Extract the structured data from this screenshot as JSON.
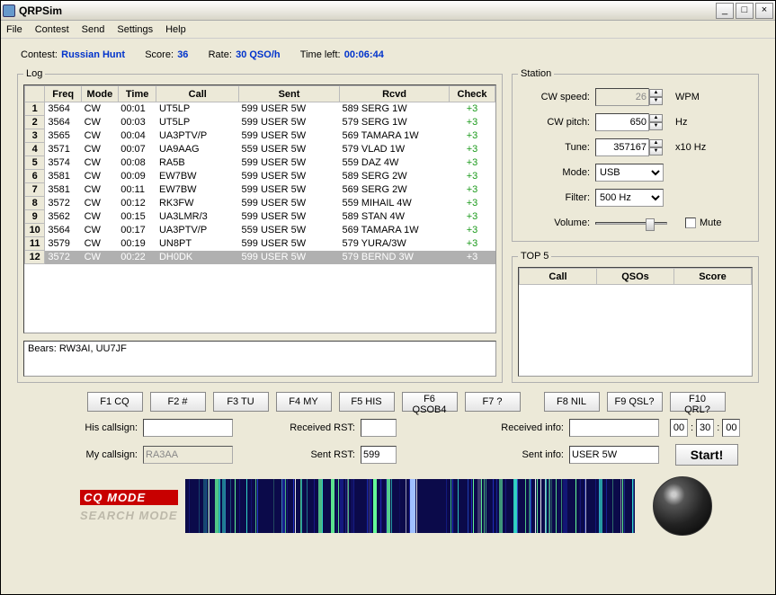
{
  "window": {
    "title": "QRPSim"
  },
  "menu": [
    "File",
    "Contest",
    "Send",
    "Settings",
    "Help"
  ],
  "summary": {
    "contest_lbl": "Contest:",
    "contest_val": "Russian Hunt",
    "score_lbl": "Score:",
    "score_val": "36",
    "rate_lbl": "Rate:",
    "rate_val": "30 QSO/h",
    "timeleft_lbl": "Time left:",
    "timeleft_val": "00:06:44"
  },
  "log": {
    "legend": "Log",
    "headers": [
      "#",
      "Freq",
      "Mode",
      "Time",
      "Call",
      "Sent",
      "Rcvd",
      "Check"
    ],
    "rows": [
      {
        "n": "1",
        "freq": "3564",
        "mode": "CW",
        "time": "00:01",
        "call": "UT5LP",
        "sent": "599 USER 5W",
        "rcvd": "589 SERG 1W",
        "check": "+3"
      },
      {
        "n": "2",
        "freq": "3564",
        "mode": "CW",
        "time": "00:03",
        "call": "UT5LP",
        "sent": "599 USER 5W",
        "rcvd": "579 SERG 1W",
        "check": "+3"
      },
      {
        "n": "3",
        "freq": "3565",
        "mode": "CW",
        "time": "00:04",
        "call": "UA3PTV/P",
        "sent": "599 USER 5W",
        "rcvd": "569 TAMARA 1W",
        "check": "+3"
      },
      {
        "n": "4",
        "freq": "3571",
        "mode": "CW",
        "time": "00:07",
        "call": "UA9AAG",
        "sent": "559 USER 5W",
        "rcvd": "579 VLAD 1W",
        "check": "+3"
      },
      {
        "n": "5",
        "freq": "3574",
        "mode": "CW",
        "time": "00:08",
        "call": "RA5B",
        "sent": "599 USER 5W",
        "rcvd": "559 DAZ 4W",
        "check": "+3"
      },
      {
        "n": "6",
        "freq": "3581",
        "mode": "CW",
        "time": "00:09",
        "call": "EW7BW",
        "sent": "599 USER 5W",
        "rcvd": "589 SERG 2W",
        "check": "+3"
      },
      {
        "n": "7",
        "freq": "3581",
        "mode": "CW",
        "time": "00:11",
        "call": "EW7BW",
        "sent": "599 USER 5W",
        "rcvd": "569 SERG 2W",
        "check": "+3"
      },
      {
        "n": "8",
        "freq": "3572",
        "mode": "CW",
        "time": "00:12",
        "call": "RK3FW",
        "sent": "599 USER 5W",
        "rcvd": "559 MIHAIL 4W",
        "check": "+3"
      },
      {
        "n": "9",
        "freq": "3562",
        "mode": "CW",
        "time": "00:15",
        "call": "UA3LMR/3",
        "sent": "599 USER 5W",
        "rcvd": "589 STAN 4W",
        "check": "+3"
      },
      {
        "n": "10",
        "freq": "3564",
        "mode": "CW",
        "time": "00:17",
        "call": "UA3PTV/P",
        "sent": "559 USER 5W",
        "rcvd": "569 TAMARA 1W",
        "check": "+3"
      },
      {
        "n": "11",
        "freq": "3579",
        "mode": "CW",
        "time": "00:19",
        "call": "UN8PT",
        "sent": "599 USER 5W",
        "rcvd": "579 YURA/3W",
        "check": "+3"
      },
      {
        "n": "12",
        "freq": "3572",
        "mode": "CW",
        "time": "00:22",
        "call": "DH0DK",
        "sent": "599 USER 5W",
        "rcvd": "579 BERND 3W",
        "check": "+3",
        "selected": true
      }
    ],
    "bears_label": "Bears: RW3AI, UU7JF"
  },
  "station": {
    "legend": "Station",
    "cw_speed_lbl": "CW speed:",
    "cw_speed": "26",
    "wpm": "WPM",
    "cw_pitch_lbl": "CW pitch:",
    "cw_pitch": "650",
    "hz": "Hz",
    "tune_lbl": "Tune:",
    "tune": "357167",
    "x10hz": "x10 Hz",
    "mode_lbl": "Mode:",
    "mode": "USB",
    "filter_lbl": "Filter:",
    "filter": "500 Hz",
    "volume_lbl": "Volume:",
    "mute_lbl": "Mute"
  },
  "top5": {
    "legend": "TOP 5",
    "headers": [
      "Call",
      "QSOs",
      "Score"
    ]
  },
  "fkeys": [
    "F1 CQ",
    "F2 #",
    "F3 TU",
    "F4 MY",
    "F5 HIS",
    "F6 QSOB4",
    "F7 ?",
    "F8 NIL",
    "F9 QSL?",
    "F10 QRL?"
  ],
  "entries": {
    "his_call_lbl": "His callsign:",
    "his_call": "",
    "rcvd_rst_lbl": "Received RST:",
    "rcvd_rst": "",
    "rcvd_info_lbl": "Received info:",
    "rcvd_info": "",
    "time_hh": "00",
    "time_mm": "30",
    "time_ss": "00",
    "my_call_lbl": "My callsign:",
    "my_call": "RA3AA",
    "sent_rst_lbl": "Sent RST:",
    "sent_rst": "599",
    "sent_info_lbl": "Sent info:",
    "sent_info": "USER 5W",
    "start_lbl": "Start!"
  },
  "modes": {
    "cq": "CQ MODE",
    "search": "SEARCH MODE"
  }
}
